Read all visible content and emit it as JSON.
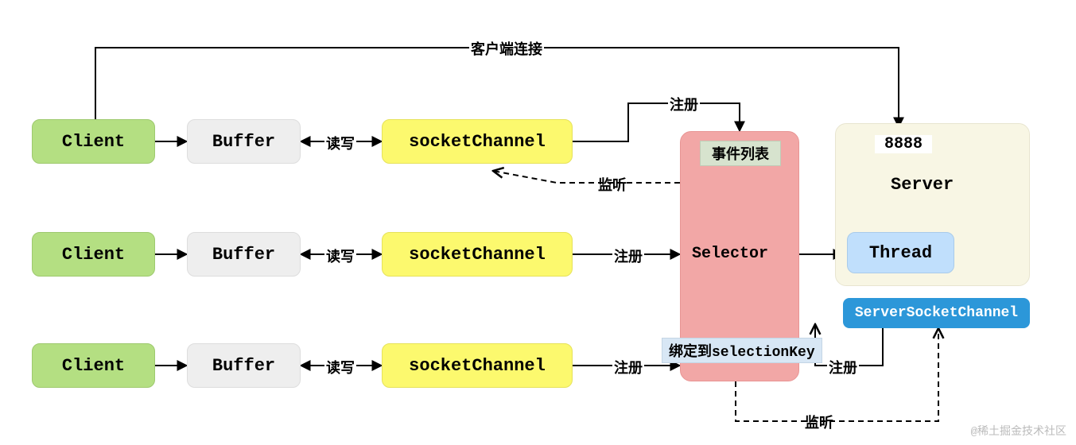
{
  "rows": [
    {
      "client": "Client",
      "buffer": "Buffer",
      "channel": "socketChannel",
      "rw": "读写",
      "reg": "注册"
    },
    {
      "client": "Client",
      "buffer": "Buffer",
      "channel": "socketChannel",
      "rw": "读写",
      "reg": "注册"
    },
    {
      "client": "Client",
      "buffer": "Buffer",
      "channel": "socketChannel",
      "rw": "读写",
      "reg": "注册"
    }
  ],
  "top_connection_label": "客户端连接",
  "listen_label_mid": "监听",
  "listen_label_bottom": "监听",
  "register_label_top": "注册",
  "register_label_ssc": "注册",
  "selector": {
    "title": "Selector",
    "event_list": "事件列表",
    "bind_key": "绑定到selectionKey"
  },
  "server": {
    "port": "8888",
    "title": "Server",
    "thread": "Thread",
    "ssc": "ServerSocketChannel"
  },
  "watermark": "@稀土掘金技术社区"
}
